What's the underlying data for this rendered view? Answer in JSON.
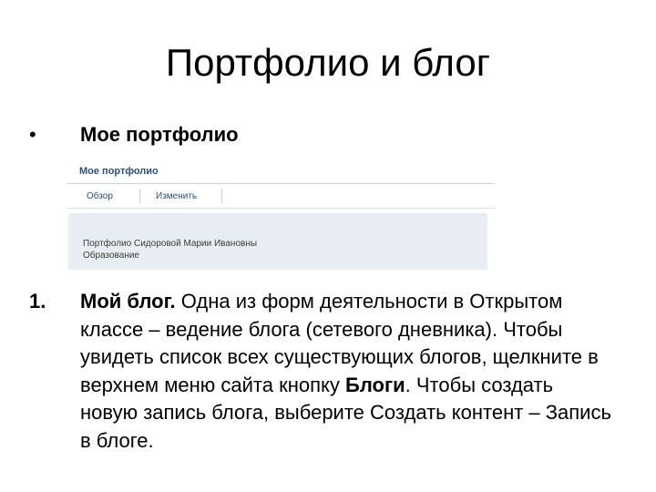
{
  "slide": {
    "title": "Портфолио и блог",
    "bullet": {
      "glyph": "•",
      "text": "Мое портфолио"
    }
  },
  "screenshot": {
    "heading": "Мое портфолио",
    "tabs": [
      {
        "label": "Обзор"
      },
      {
        "label": "Изменить"
      }
    ],
    "panel_lines": [
      "Портфолио Сидоровой Марии Ивановны",
      "Образование"
    ]
  },
  "numbered_item": {
    "number": "1.",
    "bold_lead": "Мой блог.",
    "text_1": " Одна из форм деятельности в Открытом классе – ведение блога (сетевого дневника). Чтобы увидеть список всех существующих блогов, щелкните в верхнем меню сайта кнопку ",
    "bold_mid": "Блоги",
    "text_2": ". Чтобы создать новую запись блога, выберите Создать контент – Запись в блоге."
  }
}
